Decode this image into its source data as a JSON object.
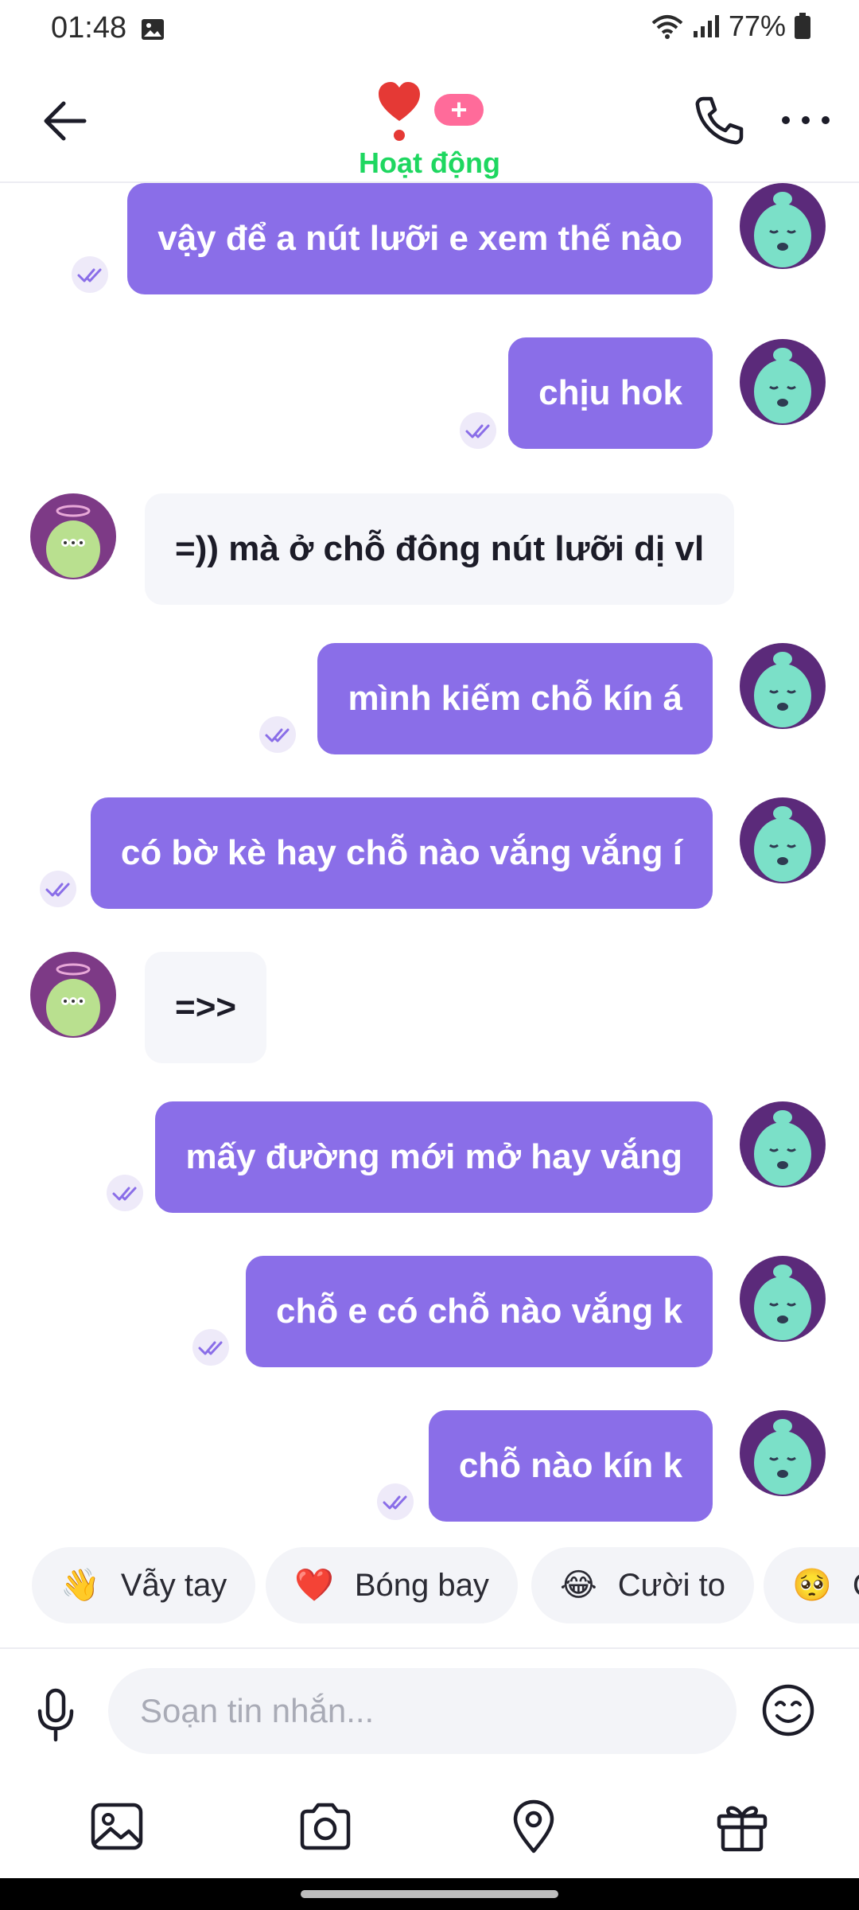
{
  "status_bar": {
    "time": "01:48",
    "battery": "77%"
  },
  "header": {
    "status": "Hoạt động",
    "plus_label": "+"
  },
  "messages": [
    {
      "dir": "out",
      "text": "vậy để a nút lưỡi e xem thế nào"
    },
    {
      "dir": "out",
      "text": "chịu hok"
    },
    {
      "dir": "in",
      "text": "=)) mà ở chỗ đông nút lưỡi dị vl"
    },
    {
      "dir": "out",
      "text": "mình kiếm chỗ kín á"
    },
    {
      "dir": "out",
      "text": "có bờ kè hay chỗ nào vắng vắng í"
    },
    {
      "dir": "in",
      "text": "=>>"
    },
    {
      "dir": "out",
      "text": "mấy đường mới mở hay vắng"
    },
    {
      "dir": "out",
      "text": "chỗ e có chỗ nào vắng k"
    },
    {
      "dir": "out",
      "text": "chỗ nào kín k"
    }
  ],
  "reactions": [
    {
      "emoji": "👋",
      "label": "Vẫy tay"
    },
    {
      "emoji": "❤️",
      "label": "Bóng bay"
    },
    {
      "emoji": "😂",
      "label": "Cười to"
    },
    {
      "emoji": "🥺",
      "label": "C"
    }
  ],
  "composer": {
    "placeholder": "Soạn tin nhắn..."
  },
  "colors": {
    "outgoing_bubble": "#8a6ee8",
    "incoming_bubble": "#f5f6fa",
    "active_status": "#1ed760",
    "badge": "#ff6b9a"
  },
  "icons": {
    "status": [
      "image-icon",
      "wifi-icon",
      "signal-icon",
      "battery-icon"
    ],
    "header": [
      "back-arrow-icon",
      "heart-icon",
      "phone-icon",
      "more-icon"
    ],
    "toolbar": [
      "gallery-icon",
      "camera-icon",
      "location-icon",
      "gift-icon"
    ],
    "composer": [
      "mic-icon",
      "emoji-icon"
    ]
  }
}
